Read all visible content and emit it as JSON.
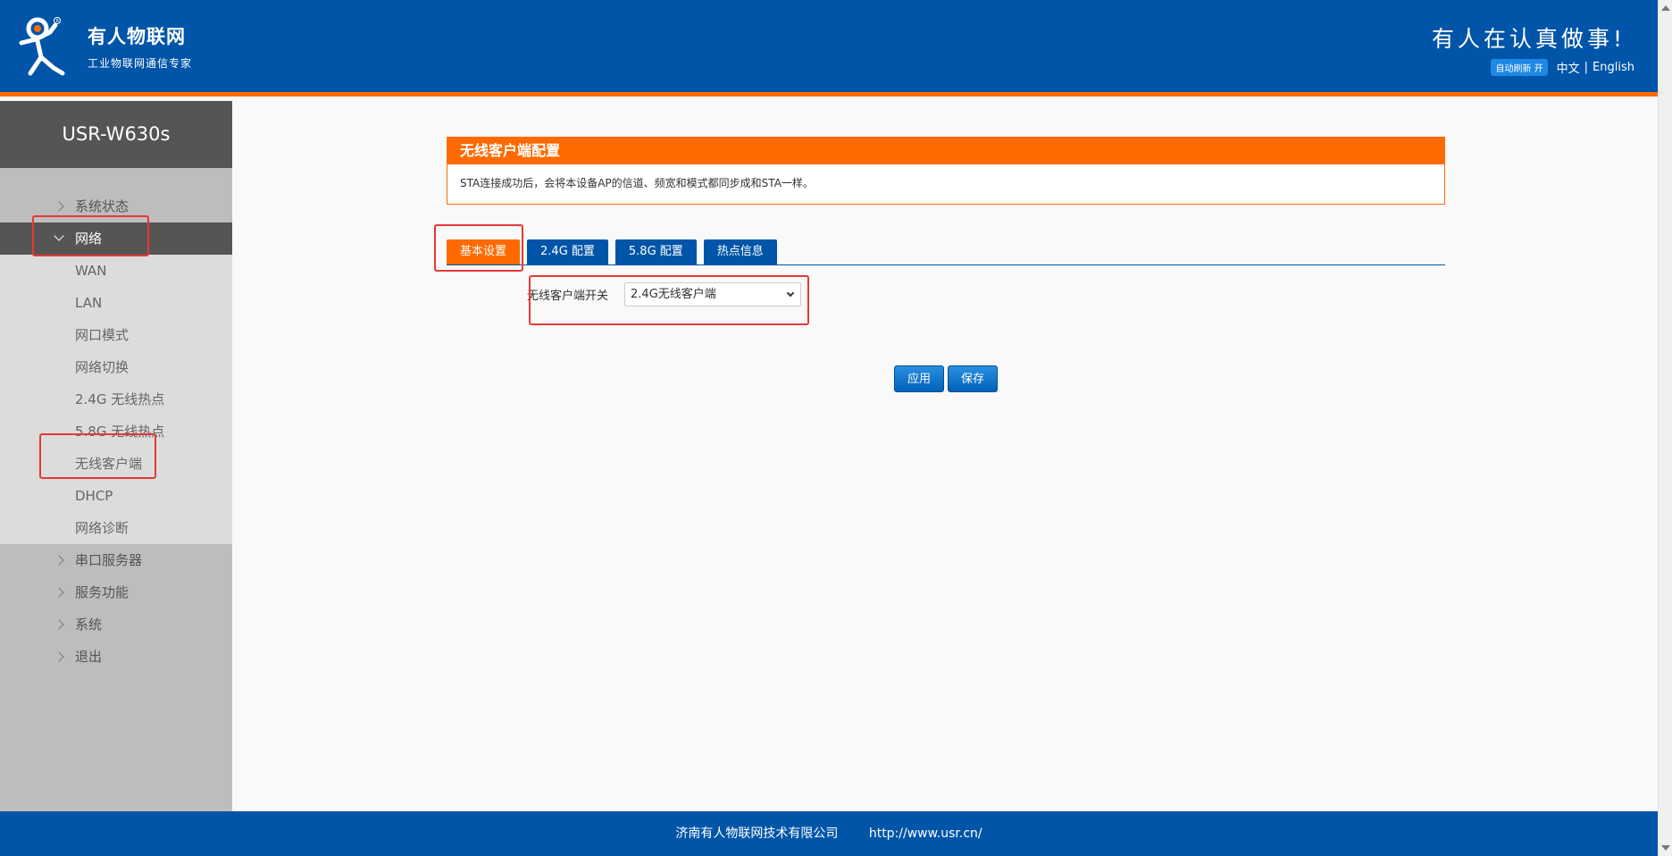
{
  "header": {
    "logo_title": "有人物联网",
    "logo_subtitle": "工业物联网通信专家",
    "slogan": "有人在认真做事!",
    "auto_refresh": "自动刷新 开",
    "lang_zh": "中文",
    "lang_sep": "|",
    "lang_en": "English"
  },
  "sidebar": {
    "device": "USR-W630s",
    "items": [
      {
        "label": "系统状态"
      },
      {
        "label": "网络"
      },
      {
        "label": "串口服务器"
      },
      {
        "label": "服务功能"
      },
      {
        "label": "系统"
      },
      {
        "label": "退出"
      }
    ],
    "network_sub": [
      {
        "label": "WAN"
      },
      {
        "label": "LAN"
      },
      {
        "label": "网口模式"
      },
      {
        "label": "网络切换"
      },
      {
        "label": "2.4G 无线热点"
      },
      {
        "label": "5.8G 无线热点"
      },
      {
        "label": "无线客户端"
      },
      {
        "label": "DHCP"
      },
      {
        "label": "网络诊断"
      }
    ]
  },
  "main": {
    "panel_title": "无线客户端配置",
    "panel_desc": "STA连接成功后，会将本设备AP的信道、频宽和模式都同步成和STA一样。",
    "tabs": [
      {
        "label": "基本设置"
      },
      {
        "label": "2.4G 配置"
      },
      {
        "label": "5.8G 配置"
      },
      {
        "label": "热点信息"
      }
    ],
    "field_label": "无线客户端开关",
    "field_value": "2.4G无线客户端",
    "apply_label": "应用",
    "save_label": "保存"
  },
  "footer": {
    "company": "济南有人物联网技术有限公司",
    "url": "http://www.usr.cn/"
  },
  "colors": {
    "brand_blue": "#0055a8",
    "accent_orange": "#ff6a00",
    "annotation_red": "#e53935"
  }
}
